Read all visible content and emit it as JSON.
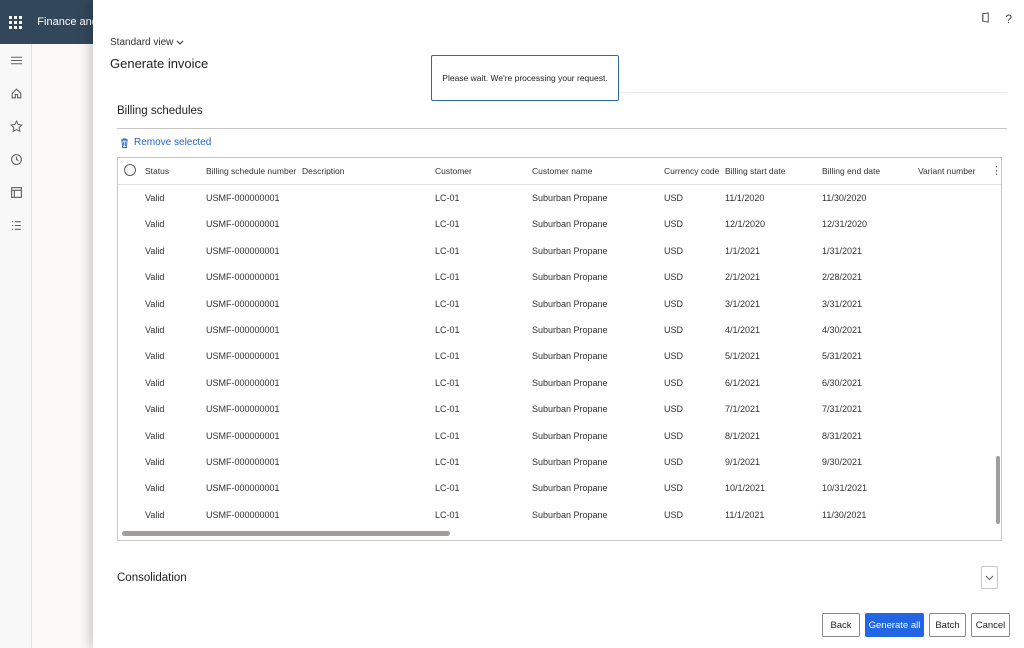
{
  "app": {
    "title": "Finance and"
  },
  "view": {
    "label": "Standard view"
  },
  "page": {
    "title": "Generate invoice"
  },
  "toast": {
    "message": "Please wait. We're processing your request."
  },
  "billing": {
    "title": "Billing schedules",
    "remove_label": "Remove selected",
    "columns": [
      "Status",
      "Billing schedule number",
      "Description",
      "Customer",
      "Customer name",
      "Currency code",
      "Billing start date",
      "Billing end date",
      "Variant number"
    ],
    "rows": [
      {
        "status": "Valid",
        "number": "USMF-000000001",
        "description": "",
        "customer": "LC-01",
        "customer_name": "Suburban Propane",
        "currency": "USD",
        "start": "11/1/2020",
        "end": "11/30/2020",
        "variant": ""
      },
      {
        "status": "Valid",
        "number": "USMF-000000001",
        "description": "",
        "customer": "LC-01",
        "customer_name": "Suburban Propane",
        "currency": "USD",
        "start": "12/1/2020",
        "end": "12/31/2020",
        "variant": ""
      },
      {
        "status": "Valid",
        "number": "USMF-000000001",
        "description": "",
        "customer": "LC-01",
        "customer_name": "Suburban Propane",
        "currency": "USD",
        "start": "1/1/2021",
        "end": "1/31/2021",
        "variant": ""
      },
      {
        "status": "Valid",
        "number": "USMF-000000001",
        "description": "",
        "customer": "LC-01",
        "customer_name": "Suburban Propane",
        "currency": "USD",
        "start": "2/1/2021",
        "end": "2/28/2021",
        "variant": ""
      },
      {
        "status": "Valid",
        "number": "USMF-000000001",
        "description": "",
        "customer": "LC-01",
        "customer_name": "Suburban Propane",
        "currency": "USD",
        "start": "3/1/2021",
        "end": "3/31/2021",
        "variant": ""
      },
      {
        "status": "Valid",
        "number": "USMF-000000001",
        "description": "",
        "customer": "LC-01",
        "customer_name": "Suburban Propane",
        "currency": "USD",
        "start": "4/1/2021",
        "end": "4/30/2021",
        "variant": ""
      },
      {
        "status": "Valid",
        "number": "USMF-000000001",
        "description": "",
        "customer": "LC-01",
        "customer_name": "Suburban Propane",
        "currency": "USD",
        "start": "5/1/2021",
        "end": "5/31/2021",
        "variant": ""
      },
      {
        "status": "Valid",
        "number": "USMF-000000001",
        "description": "",
        "customer": "LC-01",
        "customer_name": "Suburban Propane",
        "currency": "USD",
        "start": "6/1/2021",
        "end": "6/30/2021",
        "variant": ""
      },
      {
        "status": "Valid",
        "number": "USMF-000000001",
        "description": "",
        "customer": "LC-01",
        "customer_name": "Suburban Propane",
        "currency": "USD",
        "start": "7/1/2021",
        "end": "7/31/2021",
        "variant": ""
      },
      {
        "status": "Valid",
        "number": "USMF-000000001",
        "description": "",
        "customer": "LC-01",
        "customer_name": "Suburban Propane",
        "currency": "USD",
        "start": "8/1/2021",
        "end": "8/31/2021",
        "variant": ""
      },
      {
        "status": "Valid",
        "number": "USMF-000000001",
        "description": "",
        "customer": "LC-01",
        "customer_name": "Suburban Propane",
        "currency": "USD",
        "start": "9/1/2021",
        "end": "9/30/2021",
        "variant": ""
      },
      {
        "status": "Valid",
        "number": "USMF-000000001",
        "description": "",
        "customer": "LC-01",
        "customer_name": "Suburban Propane",
        "currency": "USD",
        "start": "10/1/2021",
        "end": "10/31/2021",
        "variant": ""
      },
      {
        "status": "Valid",
        "number": "USMF-000000001",
        "description": "",
        "customer": "LC-01",
        "customer_name": "Suburban Propane",
        "currency": "USD",
        "start": "11/1/2021",
        "end": "11/30/2021",
        "variant": ""
      }
    ]
  },
  "consolidation": {
    "title": "Consolidation"
  },
  "buttons": {
    "back": "Back",
    "generate_all": "Generate all",
    "batch": "Batch",
    "cancel": "Cancel"
  },
  "top_icons": {
    "help": "?"
  },
  "colors": {
    "accent": "#2266e3",
    "link": "#2266c4",
    "appbar": "#33475b"
  }
}
